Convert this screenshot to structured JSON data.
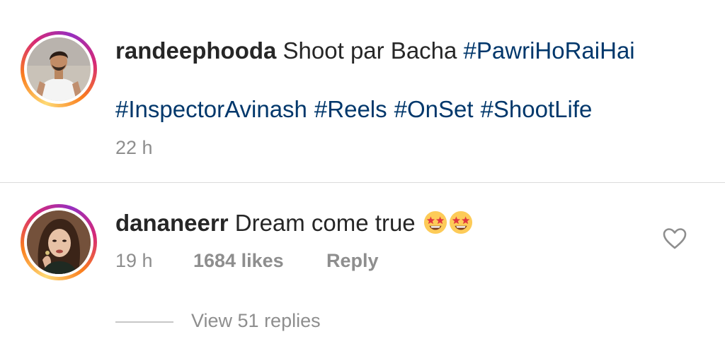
{
  "post": {
    "username": "randeephooda",
    "caption_text": "Shoot par Bacha",
    "hashtags_line1": [
      "#PawriHoRaiHai"
    ],
    "hashtags_line2": [
      "#InspectorAvinash",
      "#Reels",
      "#OnSet",
      "#ShootLife"
    ],
    "time": "22 h"
  },
  "comment": {
    "username": "dananeerr",
    "text": "Dream come true",
    "emoji": [
      "star-struck",
      "star-struck"
    ],
    "time": "19 h",
    "likes": "1684 likes",
    "reply_label": "Reply",
    "view_replies_label": "View 51 replies"
  },
  "colors": {
    "hashtag": "#00376b",
    "muted": "#8e8e8e",
    "text": "#262626",
    "divider": "#dbdbdb"
  }
}
